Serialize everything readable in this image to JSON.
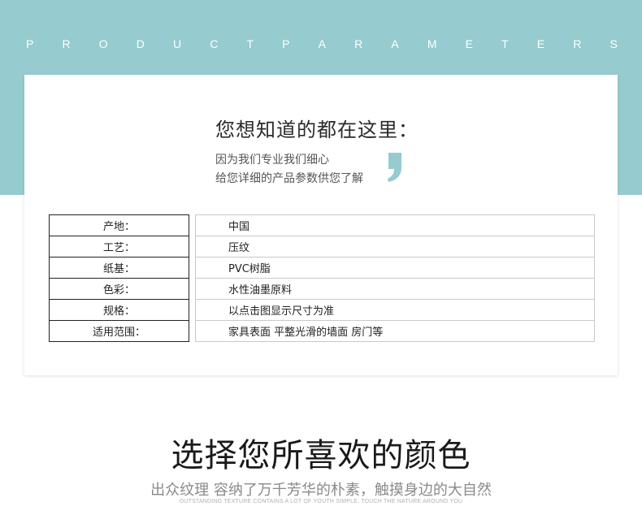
{
  "banner": {
    "letters": [
      "P",
      "R",
      "O",
      "D",
      "U",
      "C",
      "T",
      "P",
      "A",
      "R",
      "A",
      "M",
      "E",
      "T",
      "E",
      "R",
      "S"
    ],
    "color": "#96cbd0"
  },
  "card": {
    "heading": "您想知道的都在这里：",
    "subtitle_line1": "因为我们专业我们细心",
    "subtitle_line2": "给您详细的产品参数供您了解",
    "quote_icon": "closing-quote-icon",
    "quote_color": "#96cbd0"
  },
  "params": [
    {
      "label": "产地：",
      "value": "中国"
    },
    {
      "label": "工艺：",
      "value": "压纹"
    },
    {
      "label": "纸基：",
      "value": "PVC树脂"
    },
    {
      "label": "色彩：",
      "value": "水性油墨原料"
    },
    {
      "label": "规格：",
      "value": "以点击图显示尺寸为准"
    },
    {
      "label": "适用范围：",
      "value": "家具表面 平整光滑的墙面 房门等"
    }
  ],
  "section": {
    "title": "选择您所喜欢的颜色",
    "subtitle": "出众纹理 容纳了万千芳华的朴素，触摸身边的大自然",
    "english": "OUTSTANDING TEXTURE CONTAINS A LOT OF YOUTH SIMPLE, TOUCH THE NATURE AROUND YOU"
  }
}
